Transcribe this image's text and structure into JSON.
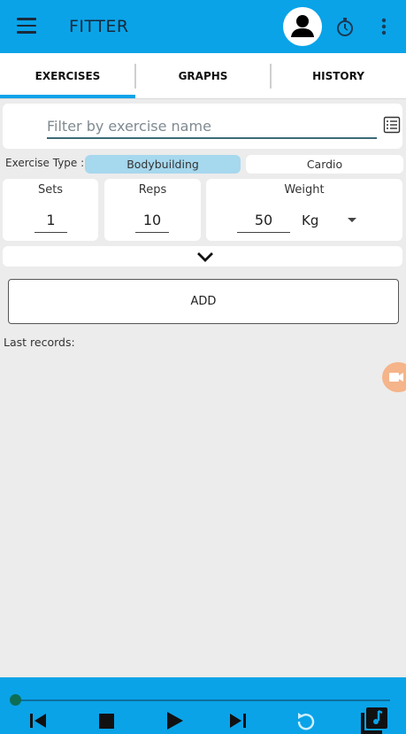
{
  "appbar": {
    "title": "FITTER",
    "menu_icon": "hamburger-menu-icon",
    "profile_icon": "account-avatar-icon",
    "timer_icon": "stopwatch-icon",
    "more_icon": "more-vert-icon"
  },
  "tabs": [
    {
      "label": "EXERCISES",
      "selected": true
    },
    {
      "label": "GRAPHS",
      "selected": false
    },
    {
      "label": "HISTORY",
      "selected": false
    }
  ],
  "filter": {
    "placeholder": "Filter by exercise name",
    "value": "",
    "list_icon": "list-icon"
  },
  "exercise_type": {
    "label": "Exercise Type :",
    "options": [
      "Bodybuilding",
      "Cardio"
    ],
    "selected": "Bodybuilding"
  },
  "fields": {
    "sets": {
      "label": "Sets",
      "value": "1"
    },
    "reps": {
      "label": "Reps",
      "value": "10"
    },
    "weight": {
      "label": "Weight",
      "value": "50",
      "unit": "Kg"
    }
  },
  "expand_icon": "chevron-down-icon",
  "add_button": {
    "label": "ADD"
  },
  "last_records": {
    "label": "Last records:"
  },
  "player": {
    "progress": 0,
    "controls": [
      "skip-previous-icon",
      "stop-icon",
      "play-icon",
      "skip-next-icon",
      "repeat-icon",
      "music-library-icon"
    ]
  },
  "colors": {
    "primary": "#0aa3e8",
    "selected_pill": "#a6d8ee",
    "background": "#ececec",
    "floating_button": "#f5b48a"
  }
}
